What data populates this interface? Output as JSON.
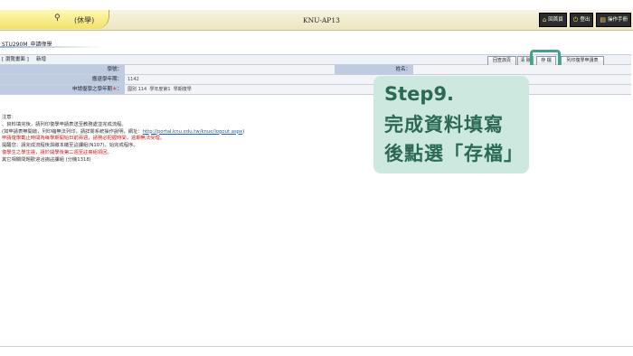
{
  "topbar": {
    "user_tab": "(休學)",
    "user_icon": "person-icon",
    "app_title": "KNU-AP13",
    "buttons": [
      {
        "label": "回首頁",
        "icon": "home-icon"
      },
      {
        "label": "登出",
        "icon": "logout-icon"
      },
      {
        "label": "操作手冊",
        "icon": "manual-icon"
      }
    ]
  },
  "page": {
    "title": "STU290M_申請復學",
    "breadcrumb": "[ 瀏覽畫面 ]",
    "mode": "新增"
  },
  "actions": {
    "btn1": "回查詢頁",
    "btn2": "清 除",
    "save": "存 檔",
    "print": "列印復學申請表"
  },
  "form": {
    "school_label": "學號：",
    "school_value": "",
    "name_label": "姓名：",
    "name_value": "",
    "year_label": "應退學年期：",
    "year_value": "1142",
    "apply_label": "申請復學之學年期",
    "apply_option1": "國別",
    "apply_value1": "114",
    "apply_text2": "學年度第1",
    "apply_text3": "學期復學"
  },
  "notes": {
    "header": "注意：",
    "line1": "、資料填完後，請列印復學申請表送至教務處並完成流程。",
    "line2a": "(如申請表無開啟，列印縮無法列印，請詳閱系統操作說明，網址：",
    "line2b": "http://portal.knu.edu.tw/knue/logout.aspx",
    "line2c": ")",
    "line3": "申請復學截止時間為每學期開始日前兩週，請務必把握時間，逾期無法受理。",
    "line4": "提醒您：請完成流程後與繳本繳至註課組(N107)，始完成程序。",
    "line5": "復學生之學生證，請於開學後第二週至註冊組領回。",
    "line6": "其它相關問題歡迎洽詢註課組 (分機1318)"
  },
  "callout": {
    "line1": "Step9.",
    "line2": "完成資料填寫",
    "line3": "後點選「存檔」"
  },
  "colors": {
    "highlight": "#3ea58b",
    "callout_bg": "#cde9df",
    "callout_text": "#2a6a55",
    "label_bg": "#bfcbe0",
    "warning": "#d41717"
  }
}
